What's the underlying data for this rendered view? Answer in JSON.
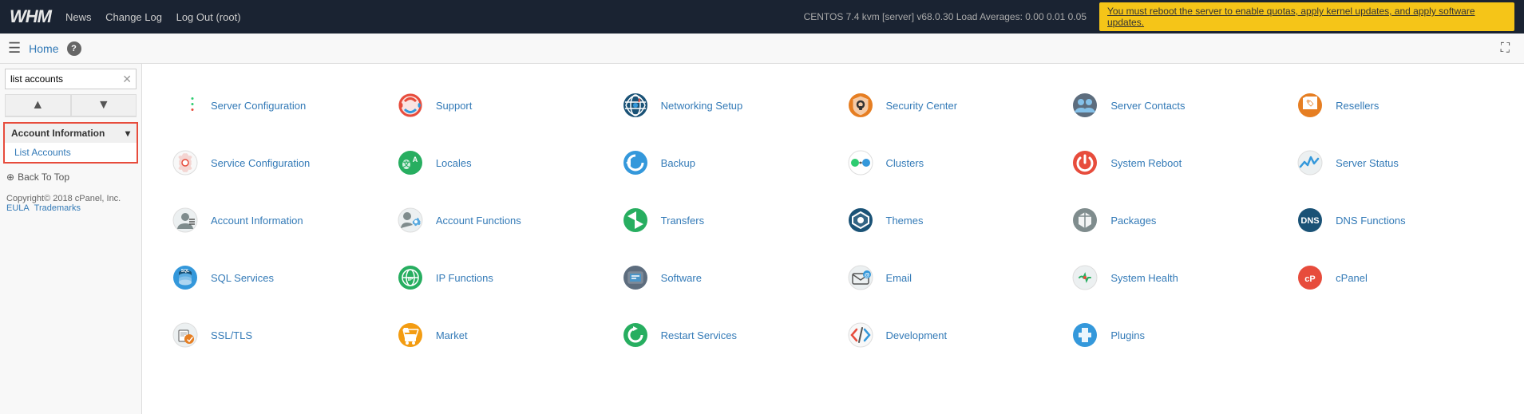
{
  "topbar": {
    "logo": "WHM",
    "nav": [
      {
        "label": "News",
        "id": "nav-news"
      },
      {
        "label": "Change Log",
        "id": "nav-changelog"
      },
      {
        "label": "Log Out (root)",
        "id": "nav-logout"
      }
    ],
    "server_info": "CENTOS 7.4 kvm [server]   v68.0.30   Load Averages: 0.00 0.01 0.05",
    "alert": "You must reboot the server to enable quotas, apply kernel updates, and apply software updates."
  },
  "secondbar": {
    "home_label": "Home",
    "help_label": "?"
  },
  "sidebar": {
    "search_value": "list accounts",
    "search_placeholder": "list accounts",
    "section_title": "Account Information",
    "items": [
      "List Accounts"
    ],
    "back_to_top": "Back To Top",
    "copyright": "Copyright© 2018 cPanel, Inc.",
    "eula": "EULA",
    "trademarks": "Trademarks"
  },
  "grid": {
    "items": [
      {
        "label": "Server Configuration",
        "icon": "server-config",
        "bg": "#5d6d7e",
        "color": "white",
        "symbol": "▤"
      },
      {
        "label": "Support",
        "icon": "support",
        "bg": "#e8f0f8",
        "color": "#e74c3c",
        "symbol": "⊕"
      },
      {
        "label": "Networking Setup",
        "icon": "networking",
        "bg": "#2471a3",
        "color": "white",
        "symbol": "⚙"
      },
      {
        "label": "Security Center",
        "icon": "security",
        "bg": "#e67e22",
        "color": "white",
        "symbol": "🔒"
      },
      {
        "label": "Server Contacts",
        "icon": "server-contacts",
        "bg": "#5d6d7e",
        "color": "white",
        "symbol": "👥"
      },
      {
        "label": "Resellers",
        "icon": "resellers",
        "bg": "#f39c12",
        "color": "white",
        "symbol": "🏷"
      },
      {
        "label": "Service Configuration",
        "icon": "service-config",
        "bg": "#e8e8e8",
        "color": "#e74c3c",
        "symbol": "🔧"
      },
      {
        "label": "Locales",
        "icon": "locales",
        "bg": "#27ae60",
        "color": "white",
        "symbol": "💬"
      },
      {
        "label": "Backup",
        "icon": "backup",
        "bg": "#3498db",
        "color": "white",
        "symbol": "↺"
      },
      {
        "label": "Clusters",
        "icon": "clusters",
        "bg": "white",
        "color": "#2ecc71",
        "symbol": "⚭"
      },
      {
        "label": "System Reboot",
        "icon": "reboot",
        "bg": "#e74c3c",
        "color": "white",
        "symbol": "⏻"
      },
      {
        "label": "Server Status",
        "icon": "server-status",
        "bg": "#5d6d7e",
        "color": "#3498db",
        "symbol": "📈"
      },
      {
        "label": "Account Information",
        "icon": "account-info",
        "bg": "#ecf0f1",
        "color": "#555",
        "symbol": "👤"
      },
      {
        "label": "Account Functions",
        "icon": "account-functions",
        "bg": "#ecf0f1",
        "color": "#555",
        "symbol": "👤⚙"
      },
      {
        "label": "Transfers",
        "icon": "transfers",
        "bg": "#27ae60",
        "color": "white",
        "symbol": "⇄"
      },
      {
        "label": "Themes",
        "icon": "themes",
        "bg": "#2471a3",
        "color": "white",
        "symbol": "◈"
      },
      {
        "label": "Packages",
        "icon": "packages",
        "bg": "#7f8c8d",
        "color": "white",
        "symbol": "📦"
      },
      {
        "label": "DNS Functions",
        "icon": "dns",
        "bg": "#2471a3",
        "color": "white",
        "symbol": "DNS"
      },
      {
        "label": "SQL Services",
        "icon": "sql",
        "bg": "#3498db",
        "color": "white",
        "symbol": "🗄"
      },
      {
        "label": "IP Functions",
        "icon": "ip-functions",
        "bg": "#27ae60",
        "color": "white",
        "symbol": "🌐"
      },
      {
        "label": "Software",
        "icon": "software",
        "bg": "#5d6d7e",
        "color": "white",
        "symbol": "⬛"
      },
      {
        "label": "Email",
        "icon": "email",
        "bg": "#ecf0f1",
        "color": "#555",
        "symbol": "✉"
      },
      {
        "label": "System Health",
        "icon": "system-health",
        "bg": "#ecf0f1",
        "color": "#27ae60",
        "symbol": "⚕"
      },
      {
        "label": "cPanel",
        "icon": "cpanel",
        "bg": "#e74c3c",
        "color": "white",
        "symbol": "cP"
      },
      {
        "label": "SSL/TLS",
        "icon": "ssl",
        "bg": "#ecf0f1",
        "color": "#555",
        "symbol": "📄🔒"
      },
      {
        "label": "Market",
        "icon": "market",
        "bg": "#f39c12",
        "color": "white",
        "symbol": "🛒"
      },
      {
        "label": "Restart Services",
        "icon": "restart",
        "bg": "#27ae60",
        "color": "white",
        "symbol": "↺"
      },
      {
        "label": "Development",
        "icon": "development",
        "bg": "#ecf0f1",
        "color": "#e74c3c",
        "symbol": "🔧"
      },
      {
        "label": "Plugins",
        "icon": "plugins",
        "bg": "#3498db",
        "color": "white",
        "symbol": "🔌"
      }
    ]
  }
}
